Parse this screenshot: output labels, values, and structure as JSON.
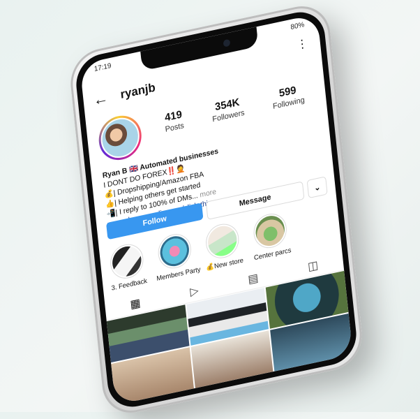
{
  "status": {
    "time": "17:19",
    "battery": "80%"
  },
  "profile": {
    "username": "ryanjb",
    "stats": [
      {
        "value": "419",
        "label": "Posts"
      },
      {
        "value": "354K",
        "label": "Followers"
      },
      {
        "value": "599",
        "label": "Following"
      }
    ],
    "bio": {
      "name": "Ryan B 🇬🇧 Automated businesses",
      "line1": "I DONT DO FOREX‼️🤦",
      "line2": "💰| Dropshipping/Amazon FBA",
      "line3": "👍| Helping others get started",
      "line4": "📲| I reply to 100% of DMs...",
      "more": "more",
      "link": "www.change-online.org/click-this"
    },
    "buttons": {
      "follow": "Follow",
      "message": "Message",
      "more": "⌄"
    }
  },
  "highlights": [
    {
      "label": "3. Feedback"
    },
    {
      "label": "Members Party"
    },
    {
      "label": "💰New store"
    },
    {
      "label": "Center parcs"
    }
  ],
  "tabs": [
    "grid-icon",
    "reels-icon",
    "guides-icon",
    "tagged-icon"
  ]
}
